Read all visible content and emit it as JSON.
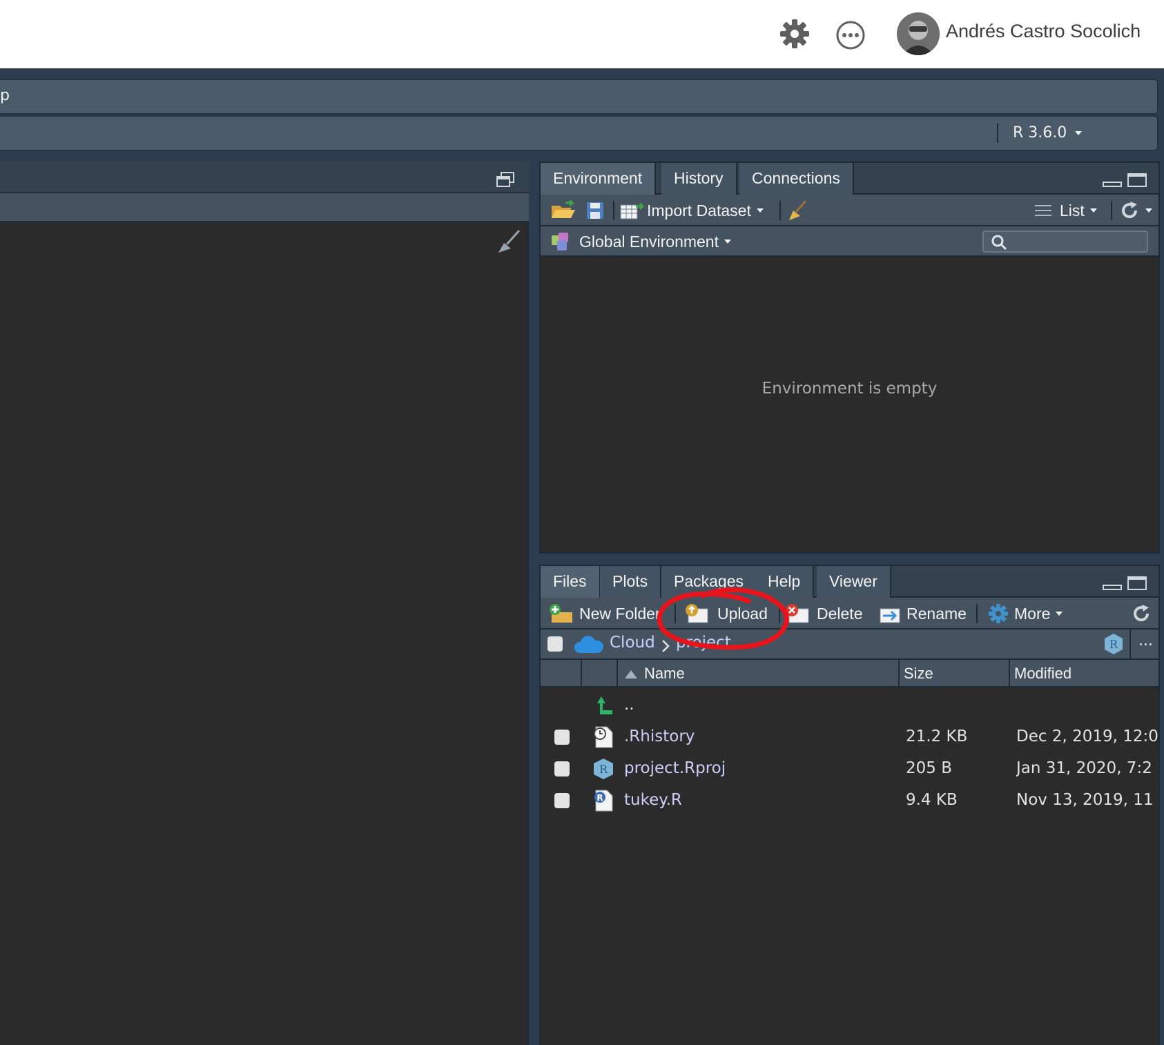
{
  "header": {
    "settings_icon": "gear-icon",
    "more_icon": "more-dots-icon",
    "user_name": "Andrés Castro Socolich"
  },
  "ide": {
    "menu_fragment": "p",
    "r_version": "R 3.6.0"
  },
  "env_pane": {
    "tabs": [
      {
        "label": "Environment",
        "active": true
      },
      {
        "label": "History",
        "active": false
      },
      {
        "label": "Connections",
        "active": false
      }
    ],
    "toolbar": {
      "import_dataset": "Import Dataset",
      "view_mode": "List"
    },
    "scope": "Global Environment",
    "empty_message": "Environment is empty"
  },
  "files_pane": {
    "tabs": [
      {
        "label": "Files",
        "active": true
      },
      {
        "label": "Plots",
        "active": false
      },
      {
        "label": "Packages",
        "active": false
      },
      {
        "label": "Help",
        "active": false
      },
      {
        "label": "Viewer",
        "active": false
      }
    ],
    "toolbar": {
      "new_folder": "New Folder",
      "upload": "Upload",
      "delete": "Delete",
      "rename": "Rename",
      "more": "More"
    },
    "breadcrumb": {
      "root": "Cloud",
      "current": "project",
      "ellipsis": "..."
    },
    "columns": {
      "name": "Name",
      "size": "Size",
      "modified": "Modified"
    },
    "parent_link": "..",
    "files": [
      {
        "name": ".Rhistory",
        "size": "21.2 KB",
        "modified": "Dec 2, 2019, 12:0",
        "icon": "history-file-icon"
      },
      {
        "name": "project.Rproj",
        "size": "205 B",
        "modified": "Jan 31, 2020, 7:2",
        "icon": "rproj-file-icon"
      },
      {
        "name": "tukey.R",
        "size": "9.4 KB",
        "modified": "Nov 13, 2019, 11",
        "icon": "r-file-icon"
      }
    ]
  },
  "annotation_color": "#e8141b"
}
